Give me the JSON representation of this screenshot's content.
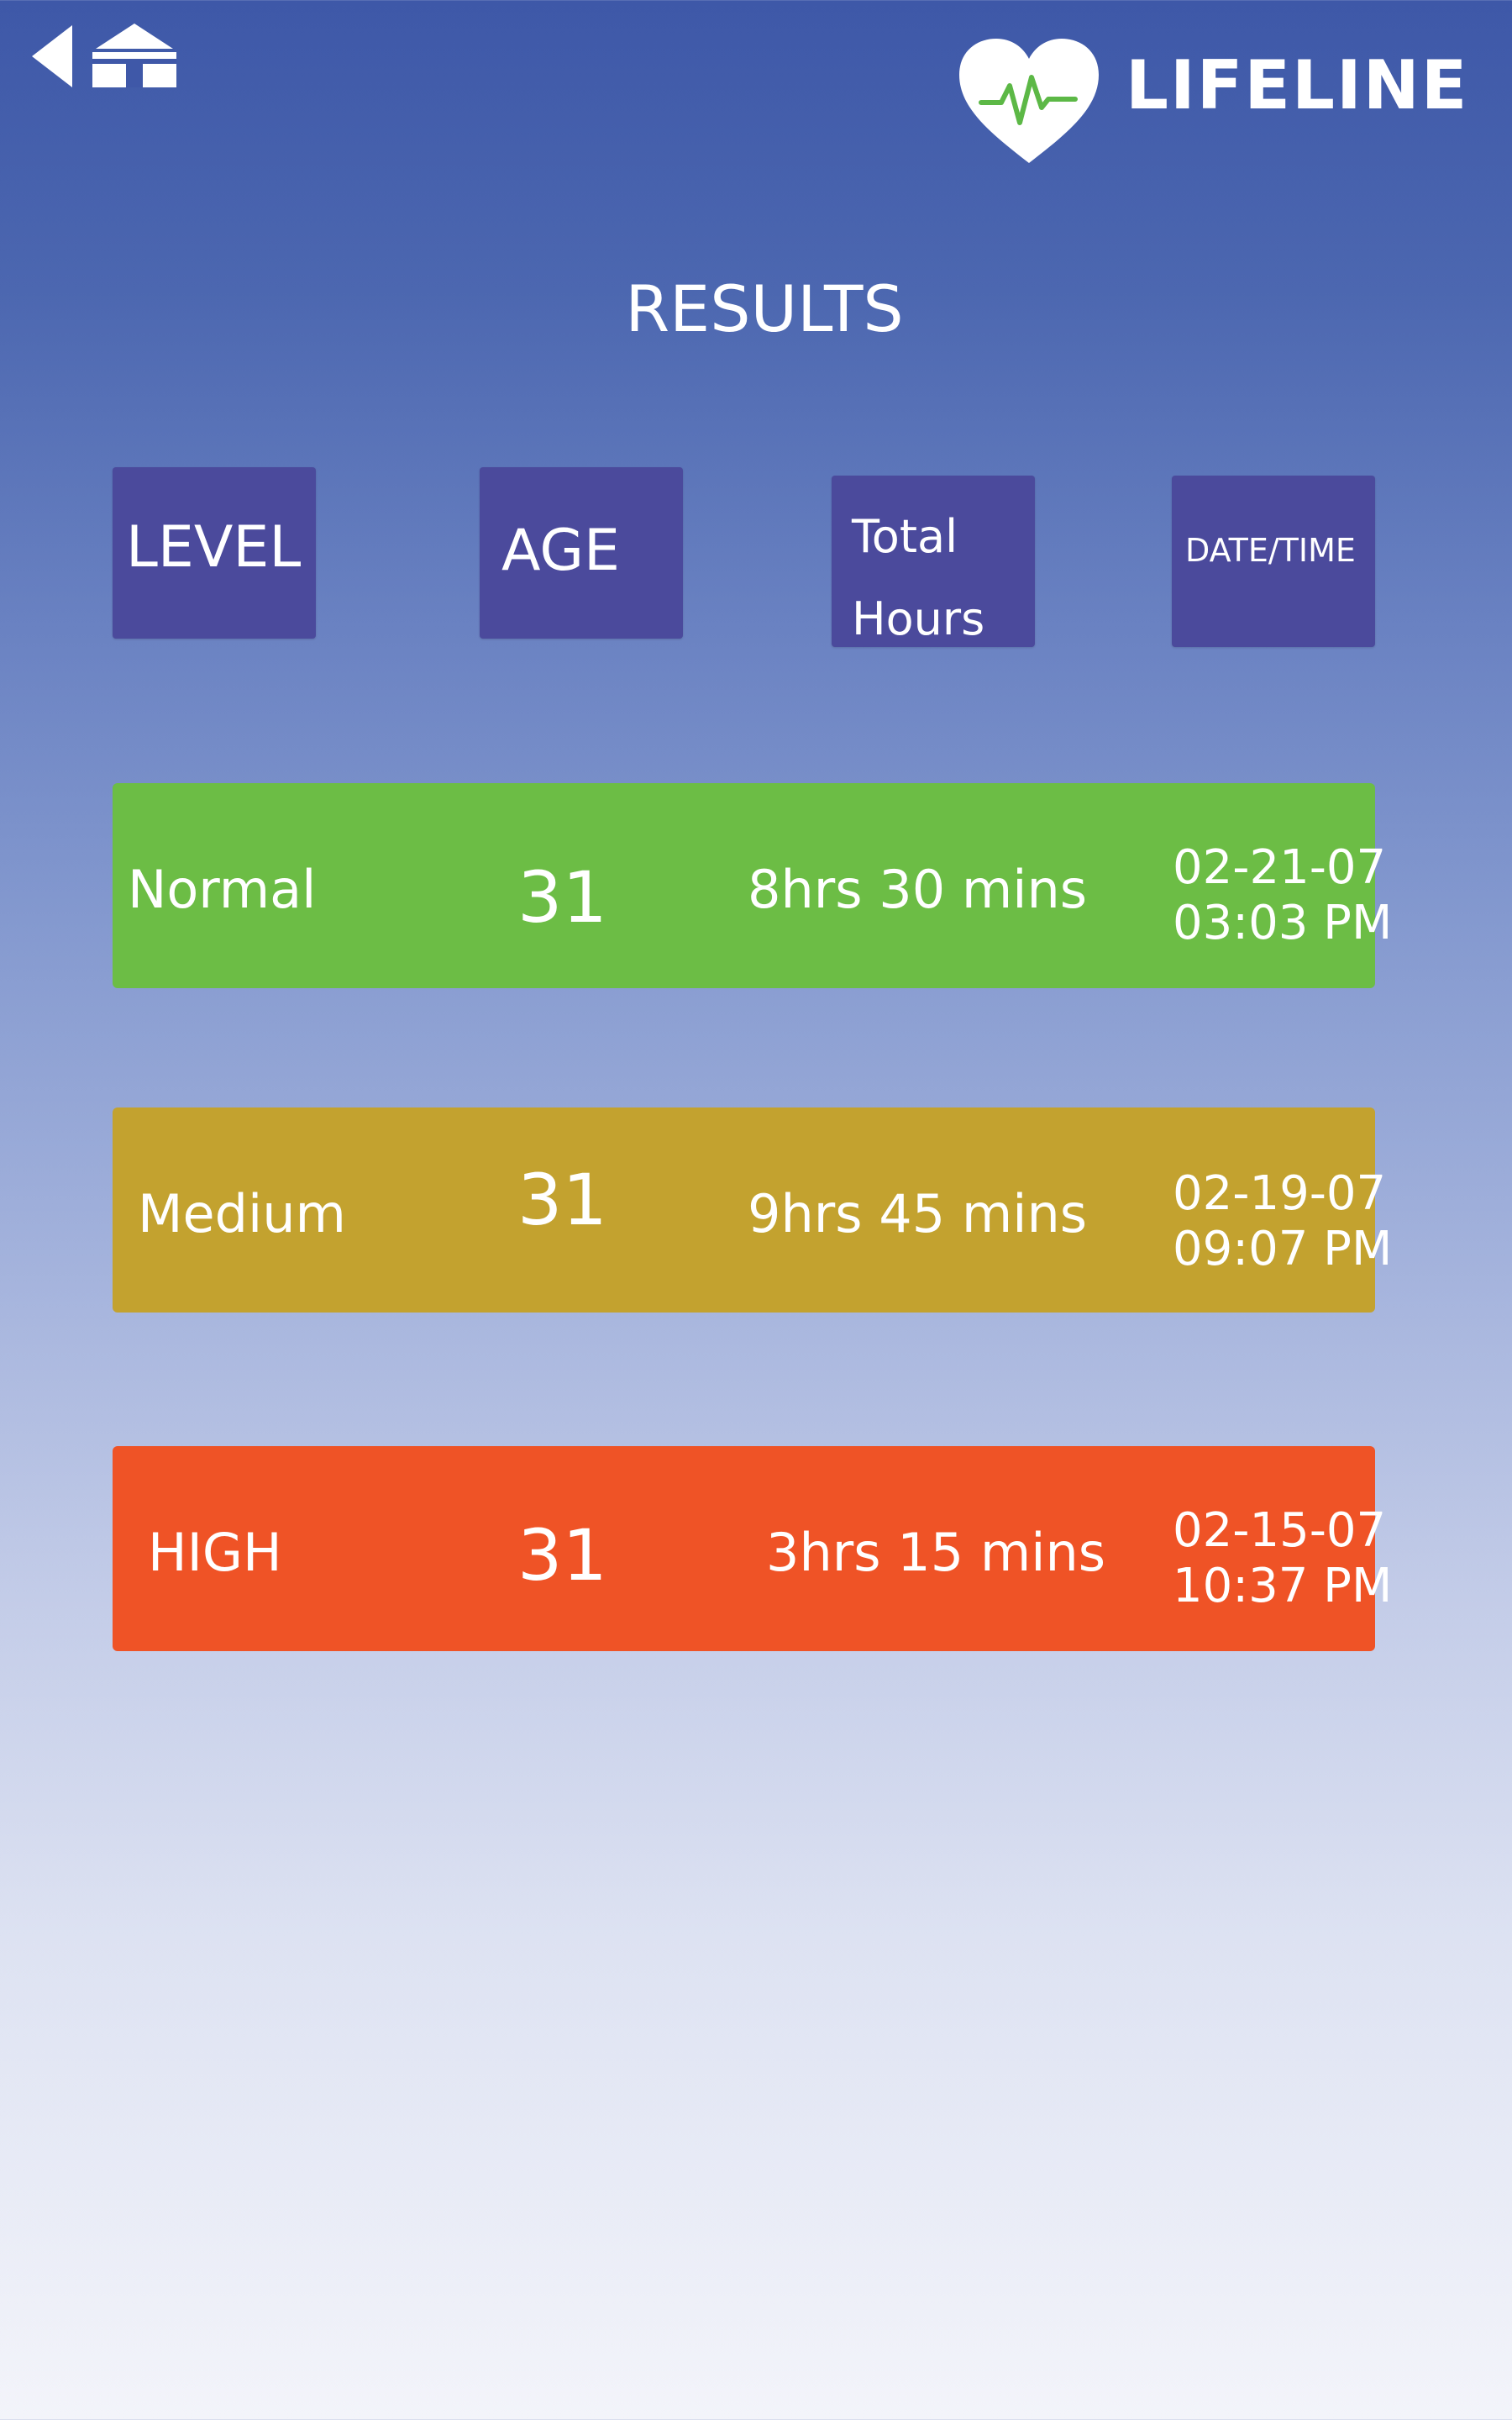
{
  "nav": {
    "back_icon": "back-arrow-icon",
    "home_icon": "home-icon"
  },
  "brand": {
    "name": "LIFELINE",
    "logo_icon": "heart-pulse-icon",
    "accent": "#5cb846"
  },
  "page": {
    "title": "RESULTS"
  },
  "columns": [
    {
      "label": "LEVEL"
    },
    {
      "label": "AGE"
    },
    {
      "label": "Total Hours"
    },
    {
      "label": "DATE/TIME"
    }
  ],
  "results": [
    {
      "level": "Normal",
      "age": "31",
      "hours": "8hrs 30 mins",
      "date": "02-21-07",
      "time": "03:03 PM",
      "color": "#6cbd45"
    },
    {
      "level": "Medium",
      "age": "31",
      "hours": "9hrs 45 mins",
      "date": "02-19-07",
      "time": "09:07 PM",
      "color": "#c3a22f"
    },
    {
      "level": "HIGH",
      "age": "31",
      "hours": "3hrs 15 mins",
      "date": "02-15-07",
      "time": "10:37 PM",
      "color": "#ef5326"
    }
  ]
}
